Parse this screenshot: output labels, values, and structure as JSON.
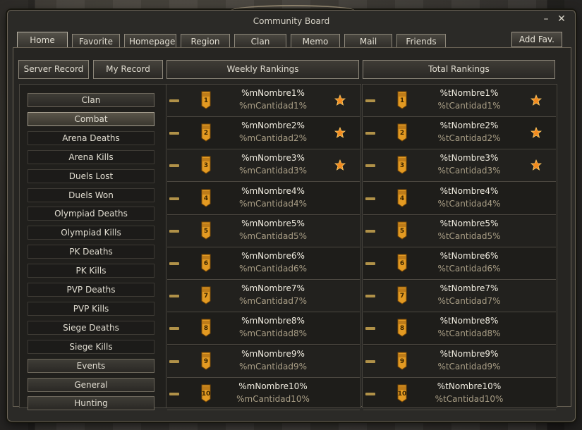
{
  "window": {
    "title": "Community Board"
  },
  "tabs": [
    {
      "label": "Home",
      "active": true
    },
    {
      "label": "Favorite"
    },
    {
      "label": "Homepage"
    },
    {
      "label": "Region"
    },
    {
      "label": "Clan"
    },
    {
      "label": "Memo"
    },
    {
      "label": "Mail"
    },
    {
      "label": "Friends"
    }
  ],
  "add_fav_label": "Add Fav.",
  "sub_buttons": {
    "server_record": "Server Record",
    "my_record": "My Record"
  },
  "headers": {
    "weekly": "Weekly Rankings",
    "total": "Total Rankings"
  },
  "categories": [
    {
      "label": "Clan",
      "type": "head"
    },
    {
      "label": "Combat",
      "type": "selected"
    },
    {
      "label": "Arena Deaths"
    },
    {
      "label": "Arena Kills"
    },
    {
      "label": "Duels Lost"
    },
    {
      "label": "Duels Won"
    },
    {
      "label": "Olympiad Deaths"
    },
    {
      "label": "Olympiad Kills"
    },
    {
      "label": "PK Deaths"
    },
    {
      "label": "PK Kills"
    },
    {
      "label": "PVP Deaths"
    },
    {
      "label": "PVP Kills"
    },
    {
      "label": "Siege Deaths"
    },
    {
      "label": "Siege Kills"
    },
    {
      "label": "Events",
      "type": "head"
    },
    {
      "label": "General",
      "type": "head"
    },
    {
      "label": "Hunting",
      "type": "head"
    }
  ],
  "weekly_rankings": [
    {
      "rank": "1",
      "name": "%mNombre1%",
      "qty": "%mCantidad1%",
      "star": true
    },
    {
      "rank": "2",
      "name": "%mNombre2%",
      "qty": "%mCantidad2%",
      "star": true
    },
    {
      "rank": "3",
      "name": "%mNombre3%",
      "qty": "%mCantidad3%",
      "star": true
    },
    {
      "rank": "4",
      "name": "%mNombre4%",
      "qty": "%mCantidad4%"
    },
    {
      "rank": "5",
      "name": "%mNombre5%",
      "qty": "%mCantidad5%"
    },
    {
      "rank": "6",
      "name": "%mNombre6%",
      "qty": "%mCantidad6%"
    },
    {
      "rank": "7",
      "name": "%mNombre7%",
      "qty": "%mCantidad7%"
    },
    {
      "rank": "8",
      "name": "%mNombre8%",
      "qty": "%mCantidad8%"
    },
    {
      "rank": "9",
      "name": "%mNombre9%",
      "qty": "%mCantidad9%"
    },
    {
      "rank": "10",
      "name": "%mNombre10%",
      "qty": "%mCantidad10%"
    }
  ],
  "total_rankings": [
    {
      "rank": "1",
      "name": "%tNombre1%",
      "qty": "%tCantidad1%",
      "star": true
    },
    {
      "rank": "2",
      "name": "%tNombre2%",
      "qty": "%tCantidad2%",
      "star": true
    },
    {
      "rank": "3",
      "name": "%tNombre3%",
      "qty": "%tCantidad3%",
      "star": true
    },
    {
      "rank": "4",
      "name": "%tNombre4%",
      "qty": "%tCantidad4%"
    },
    {
      "rank": "5",
      "name": "%tNombre5%",
      "qty": "%tCantidad5%"
    },
    {
      "rank": "6",
      "name": "%tNombre6%",
      "qty": "%tCantidad6%"
    },
    {
      "rank": "7",
      "name": "%tNombre7%",
      "qty": "%tCantidad7%"
    },
    {
      "rank": "8",
      "name": "%tNombre8%",
      "qty": "%tCantidad8%"
    },
    {
      "rank": "9",
      "name": "%tNombre9%",
      "qty": "%tCantidad9%"
    },
    {
      "rank": "10",
      "name": "%tNombre10%",
      "qty": "%tCantidad10%"
    }
  ],
  "icons": {
    "rank_badge": "rank-badge-icon",
    "star": "star-icon",
    "trend": "trend-dash-icon",
    "minimize": "minimize-icon",
    "close": "close-icon"
  },
  "colors": {
    "badge": "#e39a22",
    "star": "#f28a1e",
    "dash": "#b09148"
  }
}
